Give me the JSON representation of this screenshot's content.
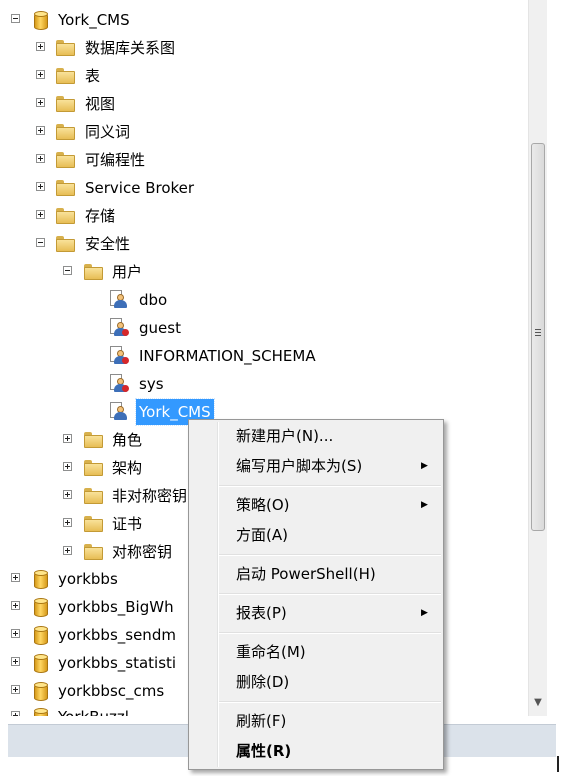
{
  "tree": {
    "db_name": "York_CMS",
    "children": [
      "数据库关系图",
      "表",
      "视图",
      "同义词",
      "可编程性",
      "Service Broker",
      "存储"
    ],
    "security": "安全性",
    "users_folder": "用户",
    "users": [
      "dbo",
      "guest",
      "INFORMATION_SCHEMA",
      "sys",
      "York_CMS"
    ],
    "security_children": [
      "角色",
      "架构",
      "非对称密钥",
      "证书",
      "对称密钥"
    ],
    "other_dbs": [
      "yorkbbs",
      "yorkbbs_BigWh",
      "yorkbbs_sendm",
      "yorkbbs_statisti",
      "yorkbbsc_cms",
      "YorkBuzzl"
    ]
  },
  "context_menu": {
    "items": [
      {
        "label": "新建用户(N)...",
        "submenu": false
      },
      {
        "label": "编写用户脚本为(S)",
        "submenu": true
      },
      {
        "label": "策略(O)",
        "submenu": true
      },
      {
        "label": "方面(A)",
        "submenu": false
      },
      {
        "label": "启动 PowerShell(H)",
        "submenu": false
      },
      {
        "label": "报表(P)",
        "submenu": true
      },
      {
        "label": "重命名(M)",
        "submenu": false
      },
      {
        "label": "删除(D)",
        "submenu": false
      },
      {
        "label": "刷新(F)",
        "submenu": false
      },
      {
        "label": "属性(R)",
        "submenu": false,
        "bold": true
      }
    ],
    "submenu_arrow": "▶"
  },
  "colors": {
    "selection": "#3399ff",
    "menu_bg": "#f0f0f0"
  },
  "icons": [
    "expand-icon",
    "collapse-icon",
    "folder-icon",
    "database-icon",
    "user-icon",
    "scroll-arrow-down-icon",
    "scroll-grip-icon"
  ]
}
